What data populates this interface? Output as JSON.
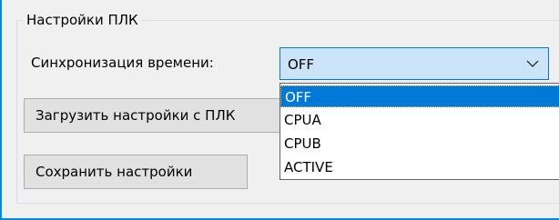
{
  "group": {
    "title": "Настройки ПЛК"
  },
  "sync": {
    "label": "Синхронизация времени:",
    "selected_value": "OFF",
    "options": [
      "OFF",
      "CPUA",
      "CPUB",
      "ACTIVE"
    ],
    "arrow_icon": "chevron-down-icon"
  },
  "buttons": {
    "load_label": "Загрузить настройки с ПЛК",
    "save_label": "Сохранить настройки"
  },
  "colors": {
    "accent": "#0078d7",
    "combo_bg": "#cce4f7",
    "window_edge": "#0a8ad6"
  }
}
